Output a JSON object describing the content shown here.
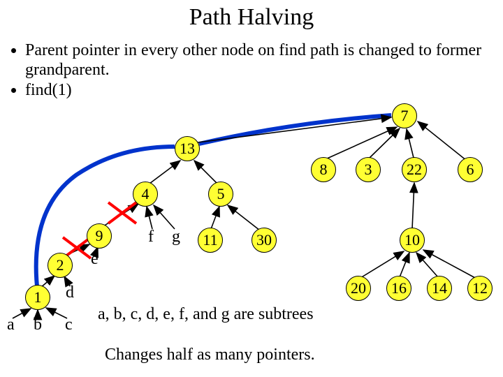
{
  "title": "Path Halving",
  "bullets": [
    "Parent pointer in every other node on find path is changed to former grandparent.",
    "find(1)"
  ],
  "nodes": {
    "n7": "7",
    "n13": "13",
    "n8": "8",
    "n3": "3",
    "n22": "22",
    "n6": "6",
    "n4": "4",
    "n5": "5",
    "n9": "9",
    "n11": "11",
    "n30": "30",
    "n10": "10",
    "n2": "2",
    "n1": "1",
    "n20": "20",
    "n16": "16",
    "n14": "14",
    "n12": "12"
  },
  "subtree_labels": {
    "f": "f",
    "g": "g",
    "e": "e",
    "d": "d",
    "a": "a",
    "b": "b",
    "c": "c"
  },
  "caption_subtrees": "a, b, c, d, e, f, and g are subtrees",
  "caption_half": "Changes half as many pointers.",
  "colors": {
    "node_fill": "#ffff33",
    "path_blue": "#0033cc",
    "cross_red": "#ff0000"
  }
}
